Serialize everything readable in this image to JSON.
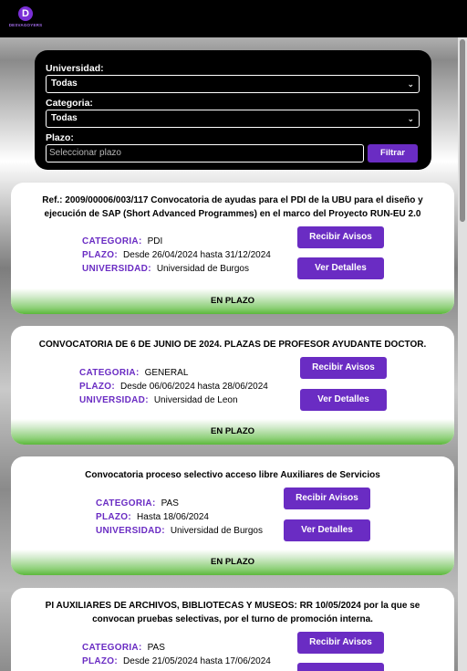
{
  "header": {
    "logo_letter": "D",
    "logo_text": "DESVAGOYERS"
  },
  "filters": {
    "universidad_label": "Universidad:",
    "universidad_value": "Todas",
    "categoria_label": "Categoria:",
    "categoria_value": "Todas",
    "plazo_label": "Plazo:",
    "plazo_placeholder": "Seleccionar plazo",
    "filter_button": "Filtrar"
  },
  "labels": {
    "categoria": "CATEGORIA:",
    "plazo": "PLAZO:",
    "universidad": "UNIVERSIDAD:",
    "avisos_button": "Recibir Avisos",
    "detalles_button": "Ver Detalles"
  },
  "cards": [
    {
      "title": "Ref.: 2009/00006/003/117 Convocatoria de ayudas para el PDI de la UBU para el diseño y ejecución de SAP (Short Advanced Programmes) en el marco del Proyecto RUN-EU 2.0",
      "categoria": "PDI",
      "plazo": "Desde 26/04/2024 hasta 31/12/2024",
      "universidad": "Universidad de Burgos",
      "status": "EN PLAZO"
    },
    {
      "title": "CONVOCATORIA DE 6 DE JUNIO DE 2024. PLAZAS DE PROFESOR AYUDANTE DOCTOR.",
      "categoria": "GENERAL",
      "plazo": "Desde 06/06/2024 hasta 28/06/2024",
      "universidad": "Universidad de Leon",
      "status": "EN PLAZO"
    },
    {
      "title": "Convocatoria proceso selectivo acceso libre Auxiliares de Servicios",
      "categoria": "PAS",
      "plazo": "Hasta 18/06/2024",
      "universidad": "Universidad de Burgos",
      "status": "EN PLAZO"
    },
    {
      "title": "PI AUXILIARES DE ARCHIVOS, BIBLIOTECAS Y MUSEOS: RR 10/05/2024 por la que se convocan pruebas selectivas, por el turno de promoción interna.",
      "categoria": "PAS",
      "plazo": "Desde 21/05/2024 hasta 17/06/2024"
    }
  ],
  "colors": {
    "accent": "#6a2cc3",
    "status_green": "#5cb83c"
  }
}
